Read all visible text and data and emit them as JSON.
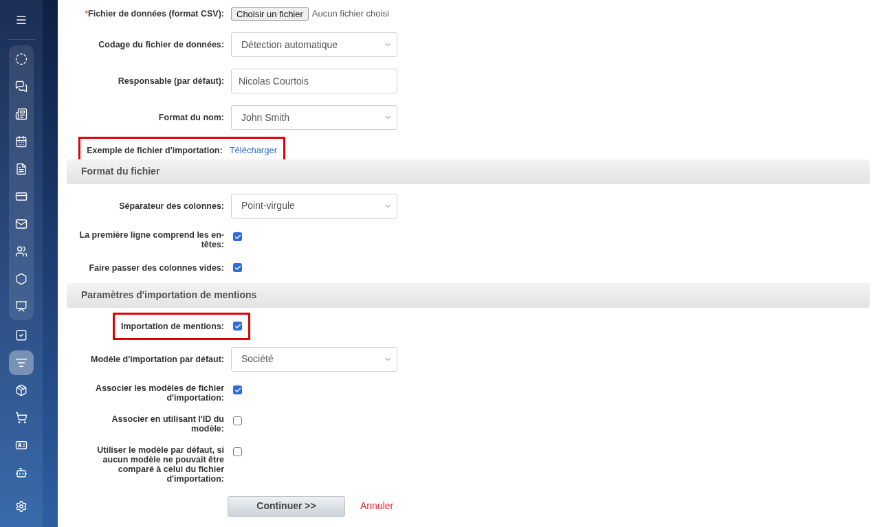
{
  "sidebar": {
    "menu_selected": false,
    "groups": [
      {
        "kind": "panel",
        "items": [
          {
            "selected": false
          },
          {
            "selected": false
          },
          {
            "selected": false
          },
          {
            "selected": false
          },
          {
            "selected": false
          },
          {
            "selected": false
          },
          {
            "selected": false
          },
          {
            "selected": false
          },
          {
            "selected": false
          },
          {
            "selected": false
          }
        ]
      },
      {
        "kind": "plain",
        "items": [
          {
            "selected": false
          },
          {
            "selected": true
          },
          {
            "selected": false
          },
          {
            "selected": false
          },
          {
            "selected": false
          },
          {
            "selected": false
          }
        ]
      }
    ],
    "settings_selected": false
  },
  "sections": [
    {
      "rows": [
        {
          "kind": "file",
          "label": "Fichier de données (format CSV):",
          "required_mark": "*",
          "highlighted": false,
          "button": "Choisir un fichier",
          "status": "Aucun fichier choisi"
        },
        {
          "kind": "select",
          "label": "Codage du fichier de données:",
          "highlighted": false,
          "value": "Détection automatique"
        },
        {
          "kind": "input",
          "label": "Responsable (par défaut):",
          "highlighted": false,
          "value": "Nicolas Courtois"
        },
        {
          "kind": "select",
          "label": "Format du nom:",
          "highlighted": false,
          "value": "John Smith"
        },
        {
          "kind": "link",
          "label": "Exemple de fichier d'importation:",
          "highlighted": true,
          "link": "Télécharger"
        }
      ]
    },
    {
      "header": "Format du fichier",
      "rows": [
        {
          "kind": "select",
          "label": "Séparateur des colonnes:",
          "highlighted": false,
          "value": "Point-virgule"
        },
        {
          "kind": "checkbox",
          "label": "La première ligne comprend les en-têtes:",
          "highlighted": false,
          "checked": true
        },
        {
          "kind": "checkbox",
          "label": "Faire passer des colonnes vides:",
          "highlighted": false,
          "checked": true
        }
      ]
    },
    {
      "header": "Paramètres d'importation de mentions",
      "rows": [
        {
          "kind": "checkbox",
          "label": "Importation de mentions:",
          "highlighted": true,
          "checked": true
        },
        {
          "kind": "select",
          "label": "Modèle d'importation par défaut:",
          "highlighted": false,
          "value": "Société"
        },
        {
          "kind": "checkbox",
          "label": "Associer les modèles de fichier d'importation:",
          "highlighted": false,
          "checked": true
        },
        {
          "kind": "checkbox",
          "label": "Associer en utilisant l'ID du modèle:",
          "highlighted": false,
          "checked": false
        },
        {
          "kind": "checkbox",
          "label": "Utiliser le modèle par défaut, si aucun modèle ne pouvait être comparé à celui du fichier d'importation:",
          "highlighted": false,
          "checked": false
        }
      ]
    }
  ],
  "actions": {
    "submit": "Continuer >>",
    "cancel": "Annuler"
  }
}
